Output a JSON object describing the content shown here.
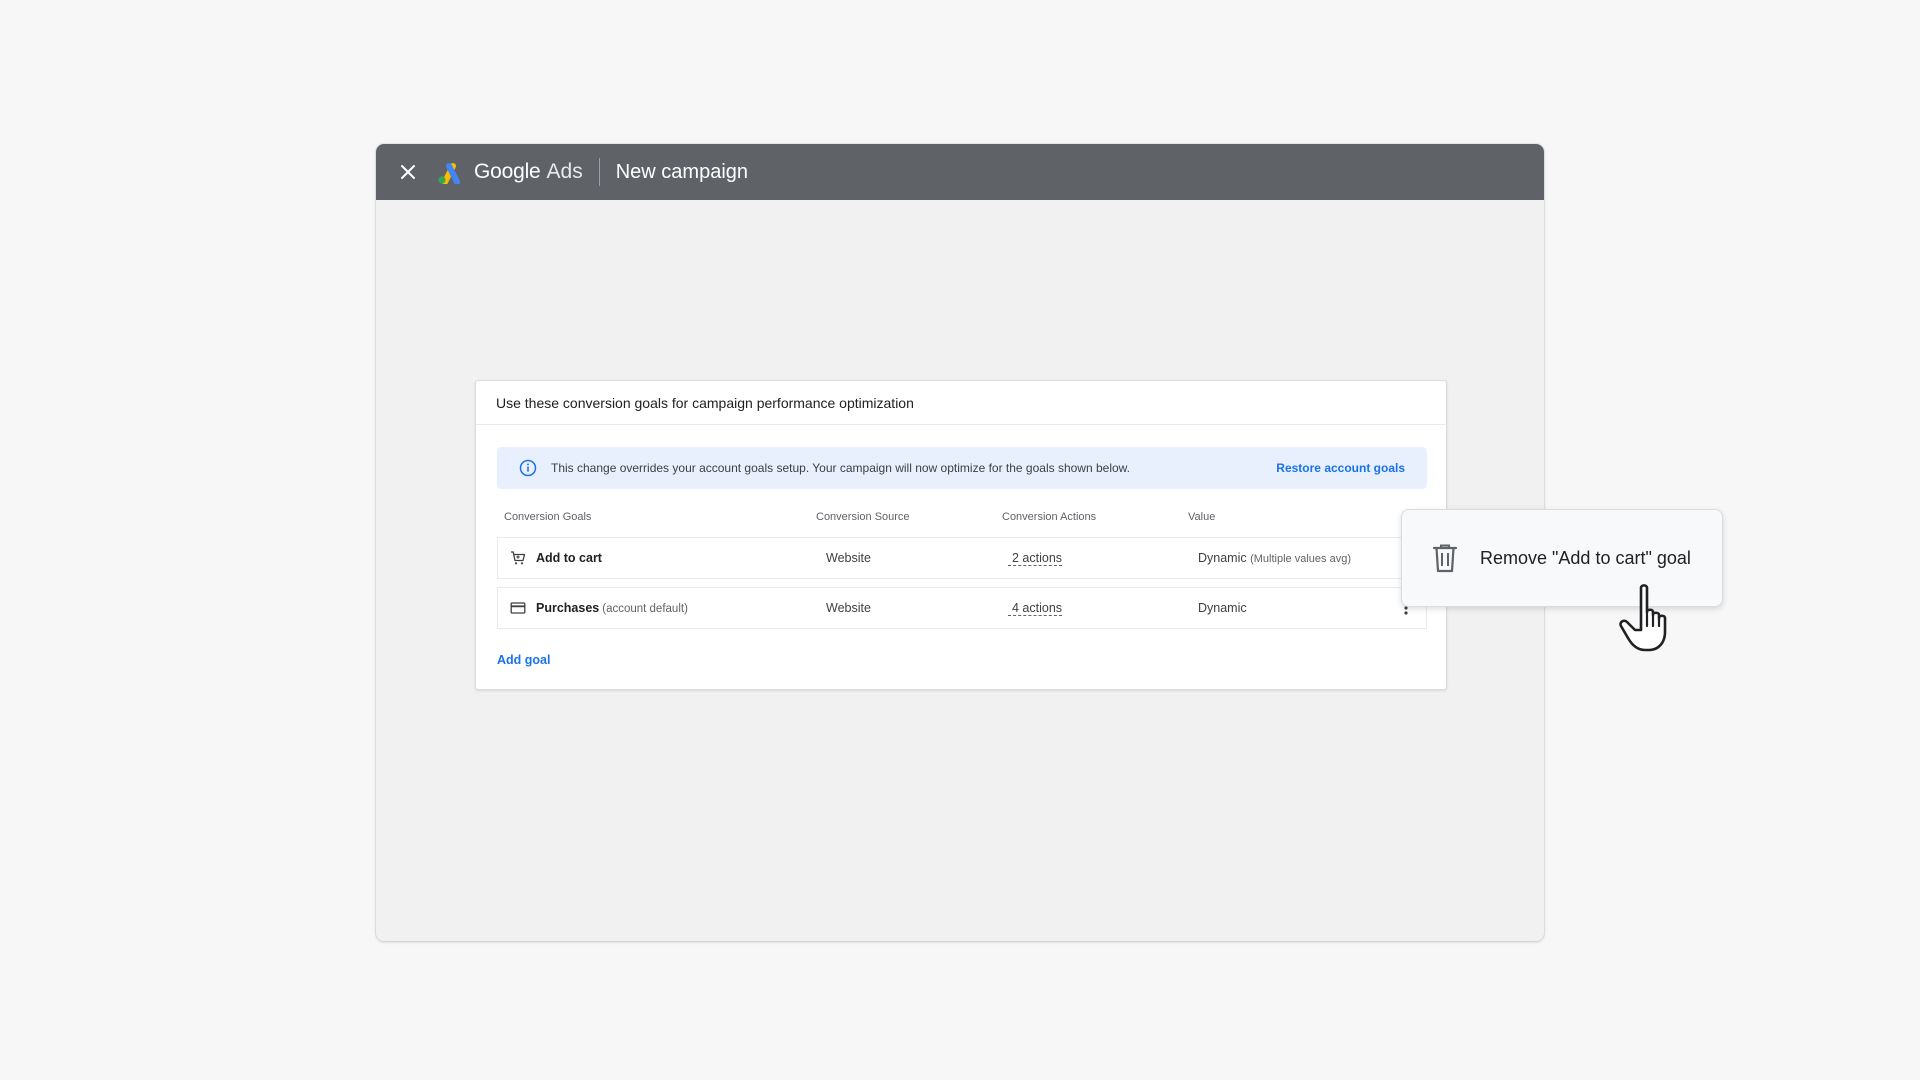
{
  "window": {
    "brand_google": "Google",
    "brand_ads": "Ads",
    "page_title": "New campaign"
  },
  "card": {
    "title": "Use these conversion goals for campaign performance optimization",
    "notice": {
      "message": "This change overrides your account goals setup. Your campaign will now optimize for the goals shown below.",
      "action": "Restore account goals"
    },
    "columns": [
      "Conversion Goals",
      "Conversion Source",
      "Conversion Actions",
      "Value"
    ],
    "rows": [
      {
        "icon": "shopping-cart-icon",
        "goal": "Add to cart",
        "goal_note": "",
        "source": "Website",
        "actions": "2 actions",
        "value": "Dynamic",
        "value_note": "(Multiple values avg)"
      },
      {
        "icon": "credit-card-icon",
        "goal": "Purchases",
        "goal_note": "(account default)",
        "source": "Website",
        "actions": "4 actions",
        "value": "Dynamic",
        "value_note": ""
      }
    ],
    "add_goal": "Add goal"
  },
  "popover": {
    "icon": "trash-icon",
    "label": "Remove \"Add to cart\" goal"
  },
  "colors": {
    "titlebar": "#5f6368",
    "accent": "#1a73e8",
    "notice_bg": "#e8f0fe"
  }
}
